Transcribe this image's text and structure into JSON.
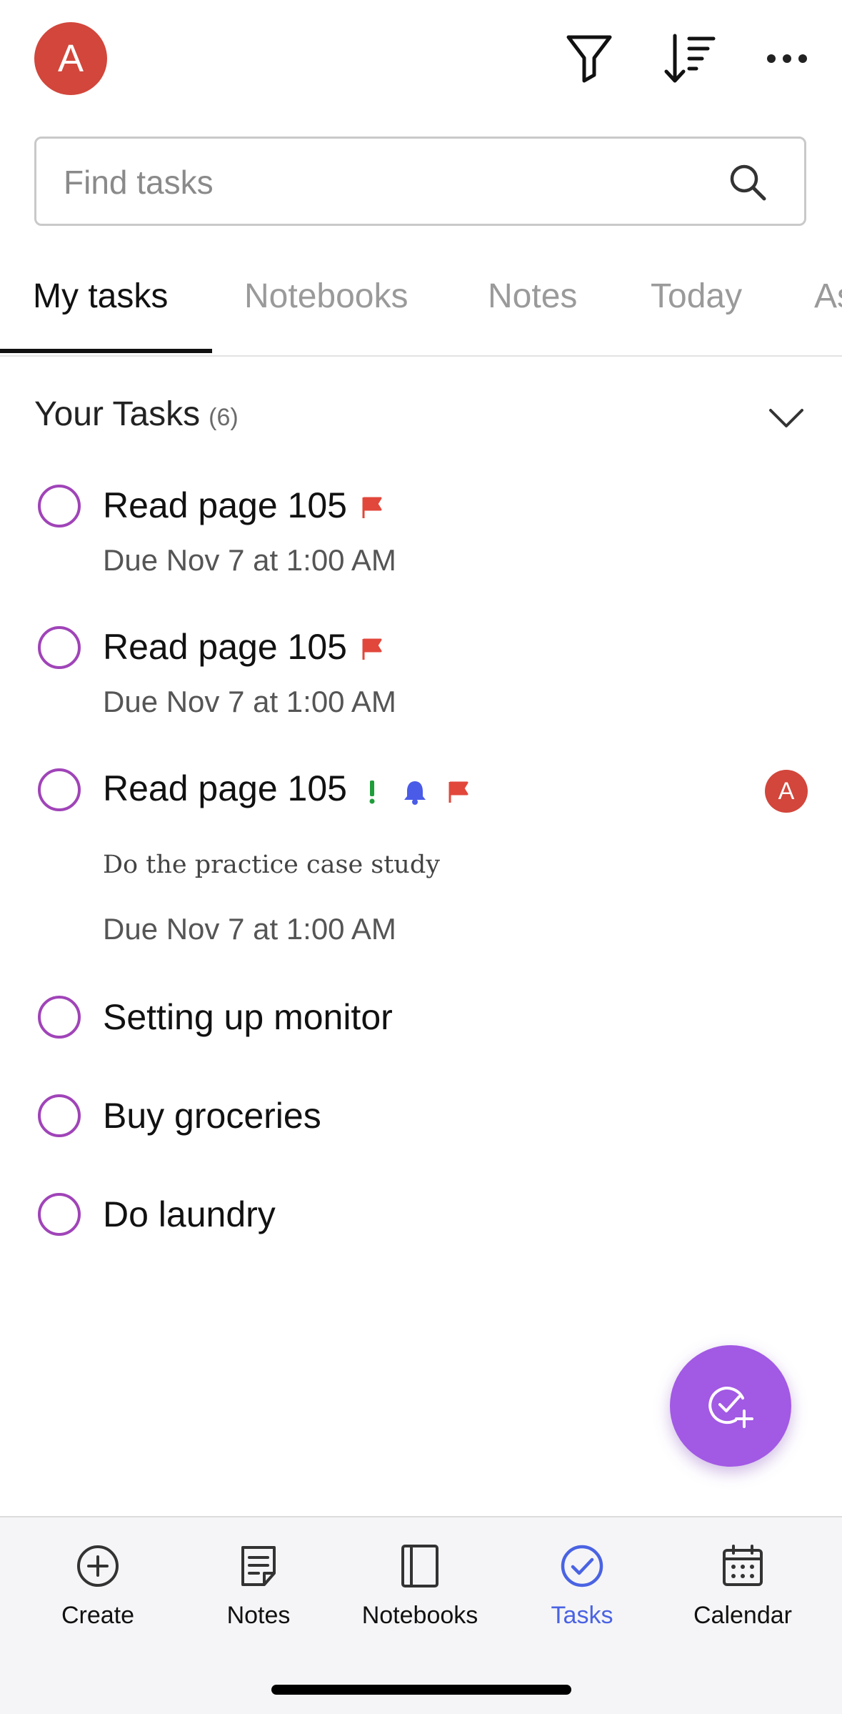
{
  "header": {
    "avatar_initial": "A",
    "icons": [
      "filter-icon",
      "sort-icon",
      "more-icon"
    ]
  },
  "search": {
    "placeholder": "Find tasks",
    "value": ""
  },
  "tabs": [
    {
      "label": "My tasks",
      "active": true
    },
    {
      "label": "Notebooks",
      "active": false
    },
    {
      "label": "Notes",
      "active": false
    },
    {
      "label": "Today",
      "active": false
    },
    {
      "label": "As",
      "active": false
    }
  ],
  "section": {
    "title": "Your Tasks",
    "count": "(6)"
  },
  "tasks": [
    {
      "title": "Read page 105",
      "due": "Due Nov 7 at 1:00 AM",
      "flag": true
    },
    {
      "title": "Read page 105",
      "due": "Due Nov 7 at 1:00 AM",
      "flag": true
    },
    {
      "title": "Read page 105",
      "note": "Do the practice case study",
      "due": "Due Nov 7 at 1:00 AM",
      "important": true,
      "reminder": true,
      "flag": true,
      "assignee_initial": "A"
    },
    {
      "title": "Setting up monitor"
    },
    {
      "title": "Buy groceries"
    },
    {
      "title": "Do laundry"
    }
  ],
  "fab": {
    "icon": "add-task-icon"
  },
  "bottom_nav": [
    {
      "label": "Create",
      "icon": "plus-circle-icon",
      "active": false
    },
    {
      "label": "Notes",
      "icon": "note-icon",
      "active": false
    },
    {
      "label": "Notebooks",
      "icon": "notebook-icon",
      "active": false
    },
    {
      "label": "Tasks",
      "icon": "check-circle-icon",
      "active": true
    },
    {
      "label": "Calendar",
      "icon": "calendar-icon",
      "active": false
    }
  ],
  "colors": {
    "accent": "#a259e4",
    "checkbox": "#a044b8",
    "avatar": "#d2463b",
    "flag": "#e2473b",
    "reminder": "#4a5be8",
    "importance": "#1f9d3a",
    "active_nav": "#4a63e3"
  }
}
